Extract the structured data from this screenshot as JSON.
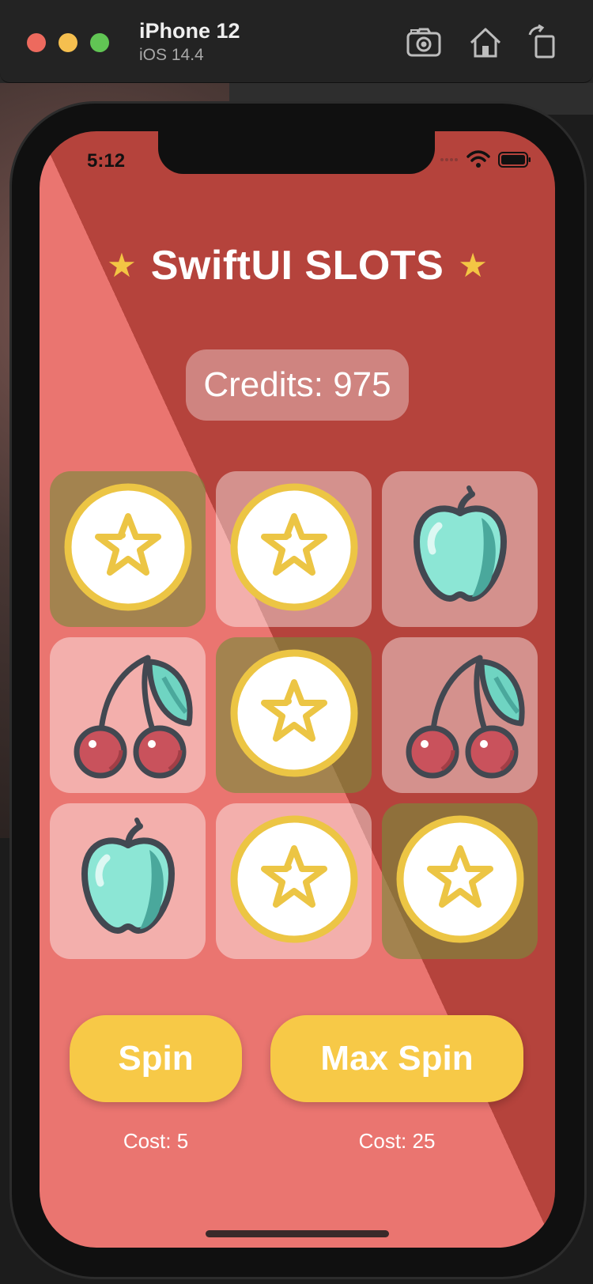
{
  "simulator": {
    "device_name": "iPhone 12",
    "os_version": "iOS 14.4",
    "toolbar_icons": [
      "camera-icon",
      "home-icon",
      "rotate-icon"
    ]
  },
  "status_bar": {
    "time": "5:12",
    "icons": [
      "signal-icon",
      "wifi-icon",
      "battery-icon"
    ]
  },
  "app": {
    "title": "SwiftUI SLOTS",
    "title_star": "★",
    "credits_label": "Credits: 975",
    "grid": [
      {
        "symbol": "star",
        "highlighted": true
      },
      {
        "symbol": "star",
        "highlighted": false
      },
      {
        "symbol": "apple",
        "highlighted": false
      },
      {
        "symbol": "cherry",
        "highlighted": false
      },
      {
        "symbol": "star",
        "highlighted": true
      },
      {
        "symbol": "cherry",
        "highlighted": false
      },
      {
        "symbol": "apple",
        "highlighted": false
      },
      {
        "symbol": "star",
        "highlighted": false
      },
      {
        "symbol": "star",
        "highlighted": true
      }
    ],
    "buttons": {
      "spin_label": "Spin",
      "max_spin_label": "Max Spin",
      "spin_cost": "Cost: 5",
      "max_spin_cost": "Cost: 25"
    }
  },
  "colors": {
    "background_light": "#ea7570",
    "background_dark": "#b5433c",
    "button": "#f7c947",
    "star_accent": "#f3c544",
    "highlight_cell": "#788c3c"
  }
}
